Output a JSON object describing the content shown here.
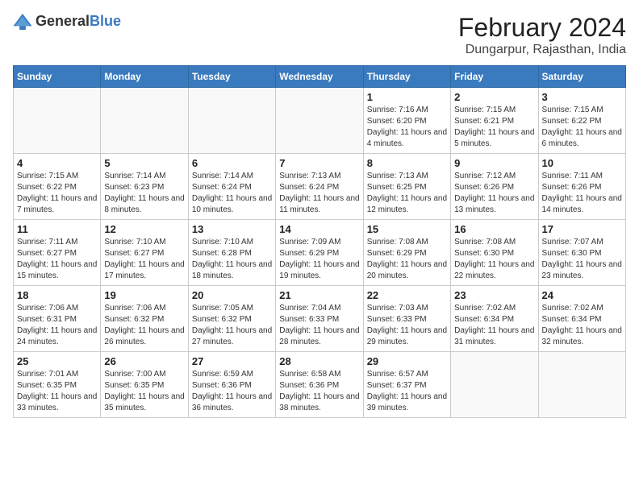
{
  "header": {
    "logo_general": "General",
    "logo_blue": "Blue",
    "month_year": "February 2024",
    "location": "Dungarpur, Rajasthan, India"
  },
  "days_of_week": [
    "Sunday",
    "Monday",
    "Tuesday",
    "Wednesday",
    "Thursday",
    "Friday",
    "Saturday"
  ],
  "weeks": [
    [
      {
        "day": "",
        "info": ""
      },
      {
        "day": "",
        "info": ""
      },
      {
        "day": "",
        "info": ""
      },
      {
        "day": "",
        "info": ""
      },
      {
        "day": "1",
        "info": "Sunrise: 7:16 AM\nSunset: 6:20 PM\nDaylight: 11 hours and 4 minutes."
      },
      {
        "day": "2",
        "info": "Sunrise: 7:15 AM\nSunset: 6:21 PM\nDaylight: 11 hours and 5 minutes."
      },
      {
        "day": "3",
        "info": "Sunrise: 7:15 AM\nSunset: 6:22 PM\nDaylight: 11 hours and 6 minutes."
      }
    ],
    [
      {
        "day": "4",
        "info": "Sunrise: 7:15 AM\nSunset: 6:22 PM\nDaylight: 11 hours and 7 minutes."
      },
      {
        "day": "5",
        "info": "Sunrise: 7:14 AM\nSunset: 6:23 PM\nDaylight: 11 hours and 8 minutes."
      },
      {
        "day": "6",
        "info": "Sunrise: 7:14 AM\nSunset: 6:24 PM\nDaylight: 11 hours and 10 minutes."
      },
      {
        "day": "7",
        "info": "Sunrise: 7:13 AM\nSunset: 6:24 PM\nDaylight: 11 hours and 11 minutes."
      },
      {
        "day": "8",
        "info": "Sunrise: 7:13 AM\nSunset: 6:25 PM\nDaylight: 11 hours and 12 minutes."
      },
      {
        "day": "9",
        "info": "Sunrise: 7:12 AM\nSunset: 6:26 PM\nDaylight: 11 hours and 13 minutes."
      },
      {
        "day": "10",
        "info": "Sunrise: 7:11 AM\nSunset: 6:26 PM\nDaylight: 11 hours and 14 minutes."
      }
    ],
    [
      {
        "day": "11",
        "info": "Sunrise: 7:11 AM\nSunset: 6:27 PM\nDaylight: 11 hours and 15 minutes."
      },
      {
        "day": "12",
        "info": "Sunrise: 7:10 AM\nSunset: 6:27 PM\nDaylight: 11 hours and 17 minutes."
      },
      {
        "day": "13",
        "info": "Sunrise: 7:10 AM\nSunset: 6:28 PM\nDaylight: 11 hours and 18 minutes."
      },
      {
        "day": "14",
        "info": "Sunrise: 7:09 AM\nSunset: 6:29 PM\nDaylight: 11 hours and 19 minutes."
      },
      {
        "day": "15",
        "info": "Sunrise: 7:08 AM\nSunset: 6:29 PM\nDaylight: 11 hours and 20 minutes."
      },
      {
        "day": "16",
        "info": "Sunrise: 7:08 AM\nSunset: 6:30 PM\nDaylight: 11 hours and 22 minutes."
      },
      {
        "day": "17",
        "info": "Sunrise: 7:07 AM\nSunset: 6:30 PM\nDaylight: 11 hours and 23 minutes."
      }
    ],
    [
      {
        "day": "18",
        "info": "Sunrise: 7:06 AM\nSunset: 6:31 PM\nDaylight: 11 hours and 24 minutes."
      },
      {
        "day": "19",
        "info": "Sunrise: 7:06 AM\nSunset: 6:32 PM\nDaylight: 11 hours and 26 minutes."
      },
      {
        "day": "20",
        "info": "Sunrise: 7:05 AM\nSunset: 6:32 PM\nDaylight: 11 hours and 27 minutes."
      },
      {
        "day": "21",
        "info": "Sunrise: 7:04 AM\nSunset: 6:33 PM\nDaylight: 11 hours and 28 minutes."
      },
      {
        "day": "22",
        "info": "Sunrise: 7:03 AM\nSunset: 6:33 PM\nDaylight: 11 hours and 29 minutes."
      },
      {
        "day": "23",
        "info": "Sunrise: 7:02 AM\nSunset: 6:34 PM\nDaylight: 11 hours and 31 minutes."
      },
      {
        "day": "24",
        "info": "Sunrise: 7:02 AM\nSunset: 6:34 PM\nDaylight: 11 hours and 32 minutes."
      }
    ],
    [
      {
        "day": "25",
        "info": "Sunrise: 7:01 AM\nSunset: 6:35 PM\nDaylight: 11 hours and 33 minutes."
      },
      {
        "day": "26",
        "info": "Sunrise: 7:00 AM\nSunset: 6:35 PM\nDaylight: 11 hours and 35 minutes."
      },
      {
        "day": "27",
        "info": "Sunrise: 6:59 AM\nSunset: 6:36 PM\nDaylight: 11 hours and 36 minutes."
      },
      {
        "day": "28",
        "info": "Sunrise: 6:58 AM\nSunset: 6:36 PM\nDaylight: 11 hours and 38 minutes."
      },
      {
        "day": "29",
        "info": "Sunrise: 6:57 AM\nSunset: 6:37 PM\nDaylight: 11 hours and 39 minutes."
      },
      {
        "day": "",
        "info": ""
      },
      {
        "day": "",
        "info": ""
      }
    ]
  ]
}
